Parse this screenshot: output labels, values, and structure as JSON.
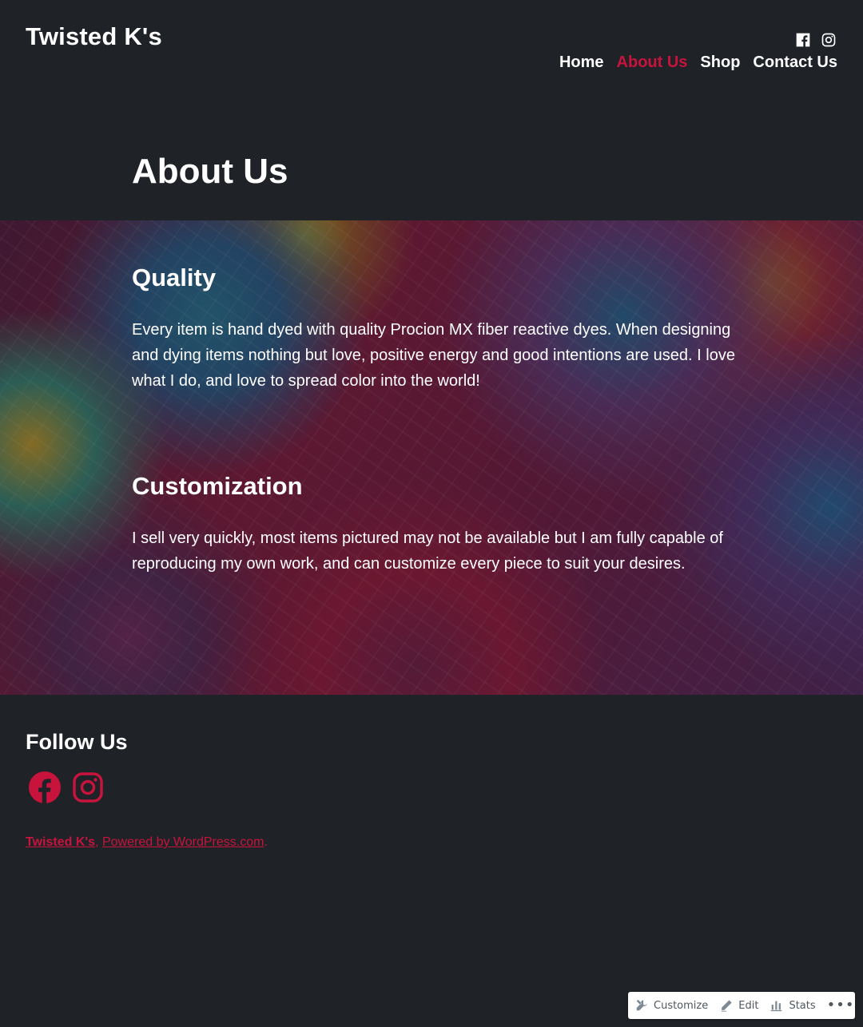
{
  "header": {
    "site_title": "Twisted K's",
    "nav": [
      {
        "label": "Home",
        "active": false
      },
      {
        "label": "About Us",
        "active": true
      },
      {
        "label": "Shop",
        "active": false
      },
      {
        "label": "Contact Us",
        "active": false
      }
    ],
    "social_icons": [
      "facebook-icon",
      "instagram-icon"
    ]
  },
  "page": {
    "title": "About Us"
  },
  "sections": [
    {
      "heading": "Quality",
      "text": "Every item is hand dyed with quality Procion MX fiber reactive dyes.  When designing and dying items nothing but love, positive energy and good intentions are used.   I love what I do, and love to spread color into the world!"
    },
    {
      "heading": "Customization",
      "text": "I sell very quickly, most items pictured may not be available but I am fully capable of reproducing my own work, and can customize every piece to suit your desires."
    }
  ],
  "footer": {
    "follow_title": "Follow Us",
    "follow_icons": [
      "facebook-icon",
      "instagram-icon"
    ],
    "credit_site": "Twisted K's",
    "credit_sep": ", ",
    "credit_powered": "Powered by WordPress.com",
    "credit_end": "."
  },
  "admin_bar": {
    "customize": "Customize",
    "edit": "Edit",
    "stats": "Stats",
    "more": "•••"
  },
  "colors": {
    "background": "#1f2327",
    "accent": "#c8133d",
    "text": "#ffffff"
  }
}
